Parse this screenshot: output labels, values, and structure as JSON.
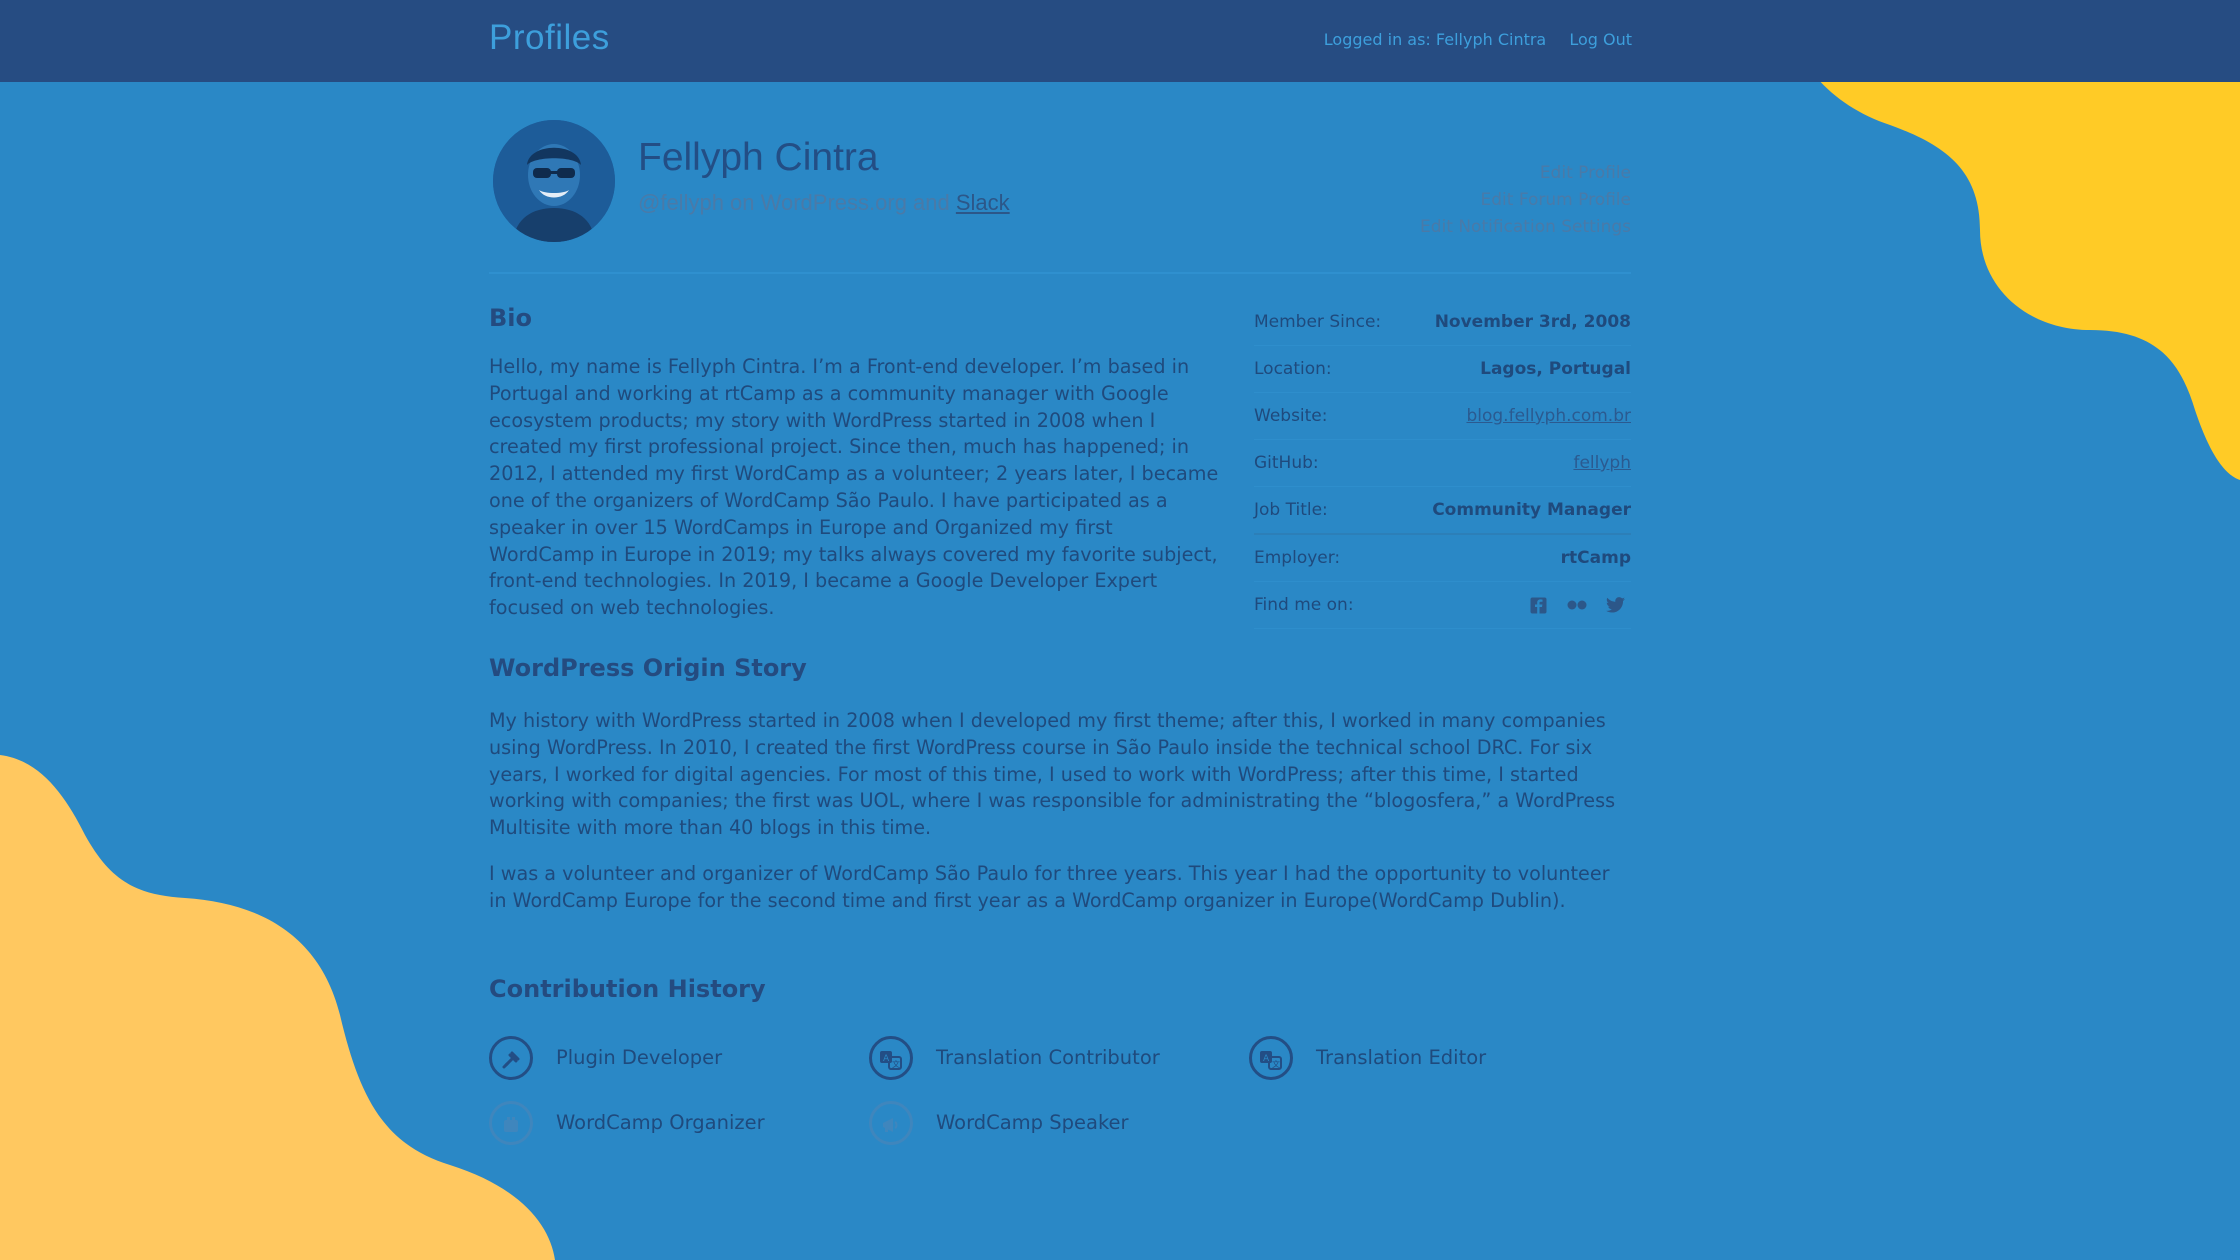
{
  "header": {
    "brand": "Profiles",
    "logged_in_text": "Logged in as: Fellyph Cintra",
    "logout_label": "Log Out"
  },
  "profile": {
    "name": "Fellyph Cintra",
    "handle_text": "@fellyph on WordPress.org and",
    "slack_label": "Slack",
    "edit_links": [
      "Edit Profile",
      "Edit Forum Profile",
      "Edit Notification Settings"
    ]
  },
  "bio": {
    "title": "Bio",
    "text": "Hello, my name is Fellyph Cintra. I’m a Front-end developer. I’m based in Portugal and working at rtCamp as a community manager with Google ecosystem products; my story with WordPress started in 2008 when I created my first professional project. Since then, much has happened; in 2012, I attended my first WordCamp as a volunteer; 2 years later, I became one of the organizers of WordCamp São Paulo. I have participated as a speaker in over 15 WordCamps in Europe and Organized my first WordCamp in Europe in 2019; my talks always covered my favorite subject, front-end technologies. In 2019, I became a Google Developer Expert focused on web technologies."
  },
  "meta": {
    "member_since": {
      "label": "Member Since:",
      "value": "November 3rd, 2008"
    },
    "location": {
      "label": "Location:",
      "value": "Lagos, Portugal"
    },
    "website": {
      "label": "Website:",
      "value": "blog.fellyph.com.br"
    },
    "github": {
      "label": "GitHub:",
      "value": "fellyph"
    },
    "job_title": {
      "label": "Job Title:",
      "value": "Community Manager"
    },
    "employer": {
      "label": "Employer:",
      "value": "rtCamp"
    },
    "find_me": {
      "label": "Find me on:",
      "icons": [
        "facebook-icon",
        "flickr-icon",
        "twitter-icon"
      ]
    }
  },
  "origin": {
    "title": "WordPress Origin Story",
    "p1": "My history with WordPress started in 2008 when I developed my first theme; after this, I worked in many companies using WordPress. In 2010, I created the first WordPress course in São Paulo inside the technical school DRC. For six years, I worked for digital agencies. For most of this time, I used to work with WordPress; after this time, I started working with companies; the first was UOL, where I was responsible for administrating the “blogosfera,” a WordPress Multisite with more than 40 blogs in this time.",
    "p2": "I was a volunteer and organizer of WordCamp São Paulo for three years. This year I had the opportunity to volunteer in WordCamp Europe for the second time and first year as a WordCamp organizer in Europe(WordCamp Dublin)."
  },
  "contributions": {
    "title": "Contribution History",
    "items": [
      {
        "label": "Plugin Developer",
        "icon": "plugin-icon"
      },
      {
        "label": "Translation Contributor",
        "icon": "translation-icon"
      },
      {
        "label": "Translation Editor",
        "icon": "translation-icon"
      },
      {
        "label": "WordCamp Organizer",
        "icon": "organizer-icon"
      },
      {
        "label": "WordCamp Speaker",
        "icon": "megaphone-icon"
      }
    ]
  },
  "colors": {
    "background": "#2a88c6",
    "topbar": "#264c82",
    "accent_yellow": "#ffcb26",
    "accent_peach": "#ffc860"
  }
}
